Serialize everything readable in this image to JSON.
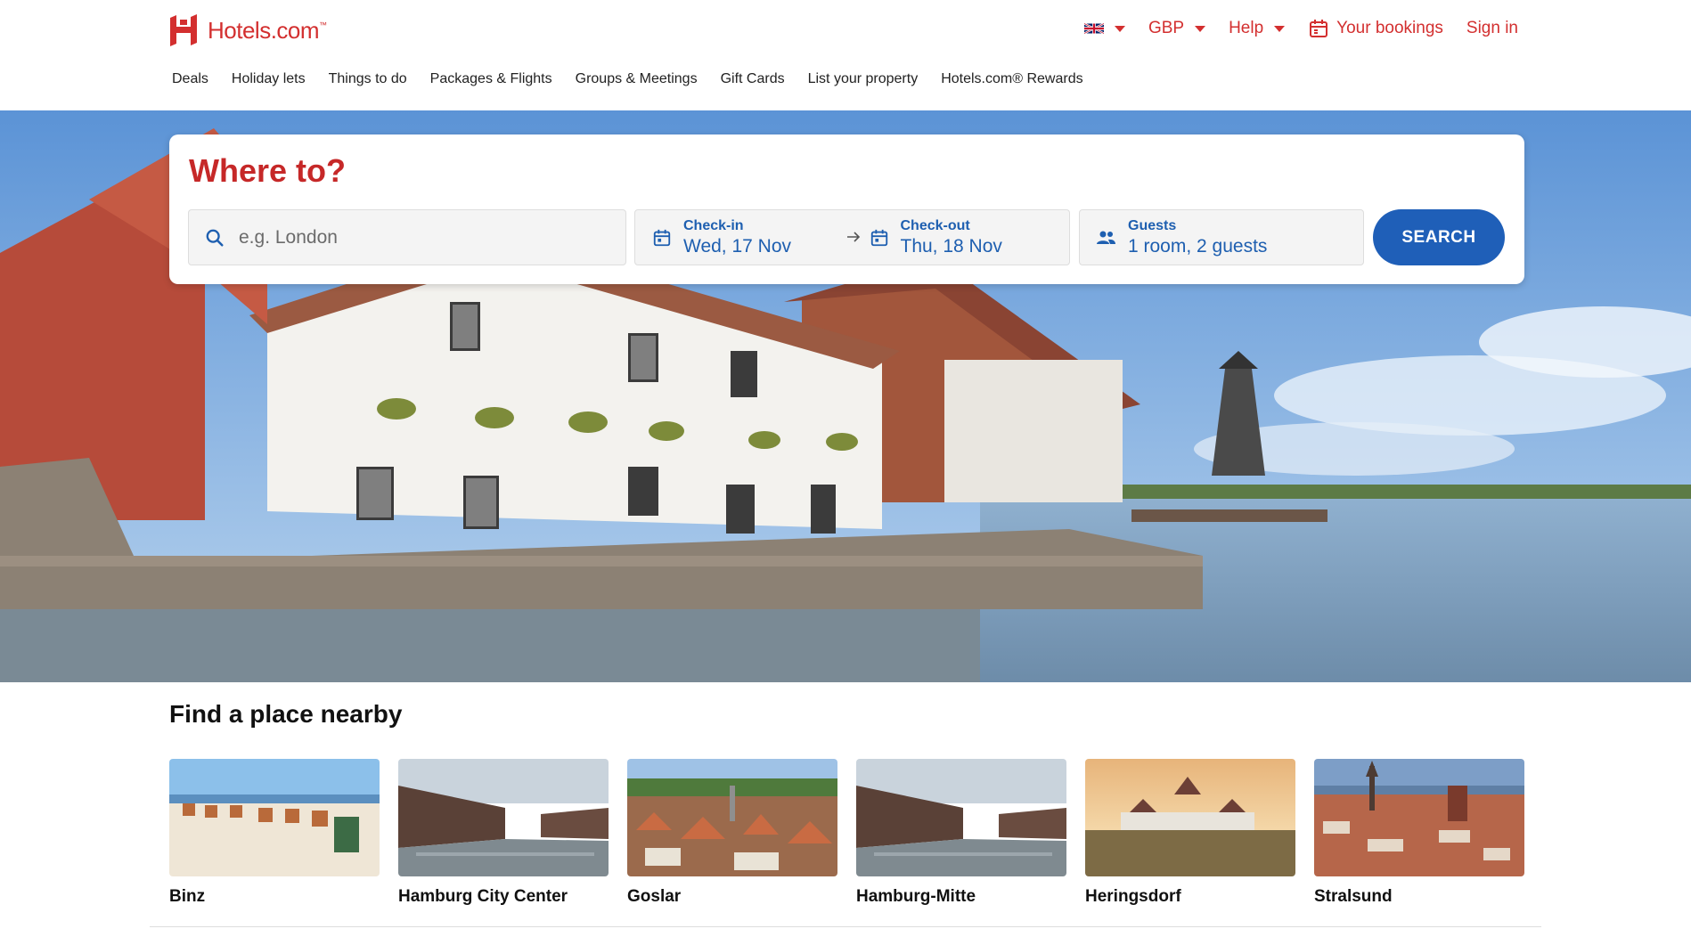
{
  "brand": {
    "name": "Hotels.com",
    "tm": "™",
    "accent": "#d32f2f",
    "primary_blue": "#1f5fb8"
  },
  "header": {
    "language_icon": "uk-flag-icon",
    "currency": "GBP",
    "help": "Help",
    "bookings": "Your bookings",
    "sign_in": "Sign in"
  },
  "nav": {
    "items": [
      "Deals",
      "Holiday lets",
      "Things to do",
      "Packages & Flights",
      "Groups & Meetings",
      "Gift Cards",
      "List your property",
      "Hotels.com® Rewards"
    ]
  },
  "search": {
    "title": "Where to?",
    "destination_placeholder": "e.g. London",
    "checkin_label": "Check-in",
    "checkin_value": "Wed, 17 Nov",
    "checkout_label": "Check-out",
    "checkout_value": "Thu, 18 Nov",
    "guests_label": "Guests",
    "guests_value": "1 room, 2 guests",
    "button": "SEARCH"
  },
  "nearby": {
    "title": "Find a place nearby",
    "places": [
      "Binz",
      "Hamburg City Center",
      "Goslar",
      "Hamburg-Mitte",
      "Heringsdorf",
      "Stralsund"
    ]
  }
}
